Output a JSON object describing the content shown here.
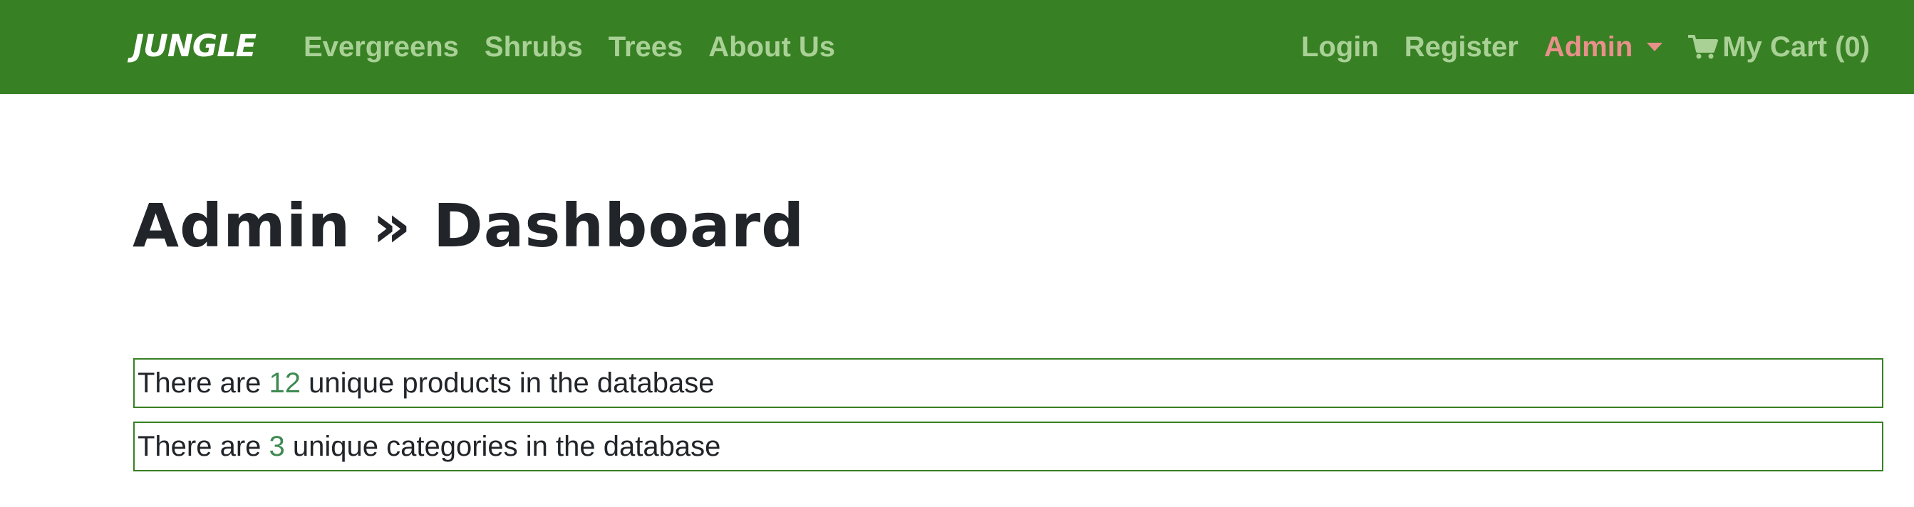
{
  "navbar": {
    "brand": "JUNGLE",
    "left_links": {
      "evergreens": "Evergreens",
      "shrubs": "Shrubs",
      "trees": "Trees",
      "about": "About Us"
    },
    "right_links": {
      "login": "Login",
      "register": "Register",
      "admin": "Admin",
      "cart": "My Cart (0)"
    },
    "cart_icon": "shopping-cart-icon",
    "admin_caret_icon": "caret-down-icon"
  },
  "main": {
    "title": "Admin » Dashboard",
    "stats": {
      "products": {
        "prefix": "There are ",
        "count": "12",
        "suffix": " unique products in the database"
      },
      "categories": {
        "prefix": "There are ",
        "count": "3",
        "suffix": " unique categories in the database"
      }
    }
  },
  "colors": {
    "navbar_bg": "#388024",
    "nav_link": "#a9d196",
    "admin_link": "#e8908a",
    "brand": "#ffffff",
    "stat_border": "#388024",
    "stat_count": "#3f8a52",
    "text": "#212529"
  }
}
